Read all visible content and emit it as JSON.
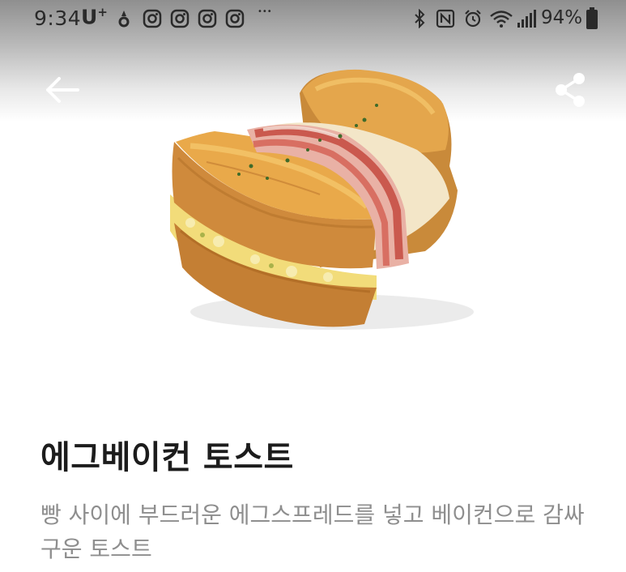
{
  "status_bar": {
    "time": "9:34",
    "carrier": "U",
    "carrier_sup": "+",
    "overflow_dots": "•••",
    "battery": "94%"
  },
  "app_bar": {
    "back_icon": "arrow-left-icon",
    "share_icon": "share-icon"
  },
  "product": {
    "name": "에그베이컨 토스트",
    "description": "빵 사이에 부드러운 에그스프레드를 넣고 베이컨으로 감싸 구운 토스트"
  },
  "colors": {
    "title": "#1c1c1c",
    "description": "#8e8e8e",
    "status_text": "#2a2a2a",
    "icon_white": "#ffffff"
  }
}
